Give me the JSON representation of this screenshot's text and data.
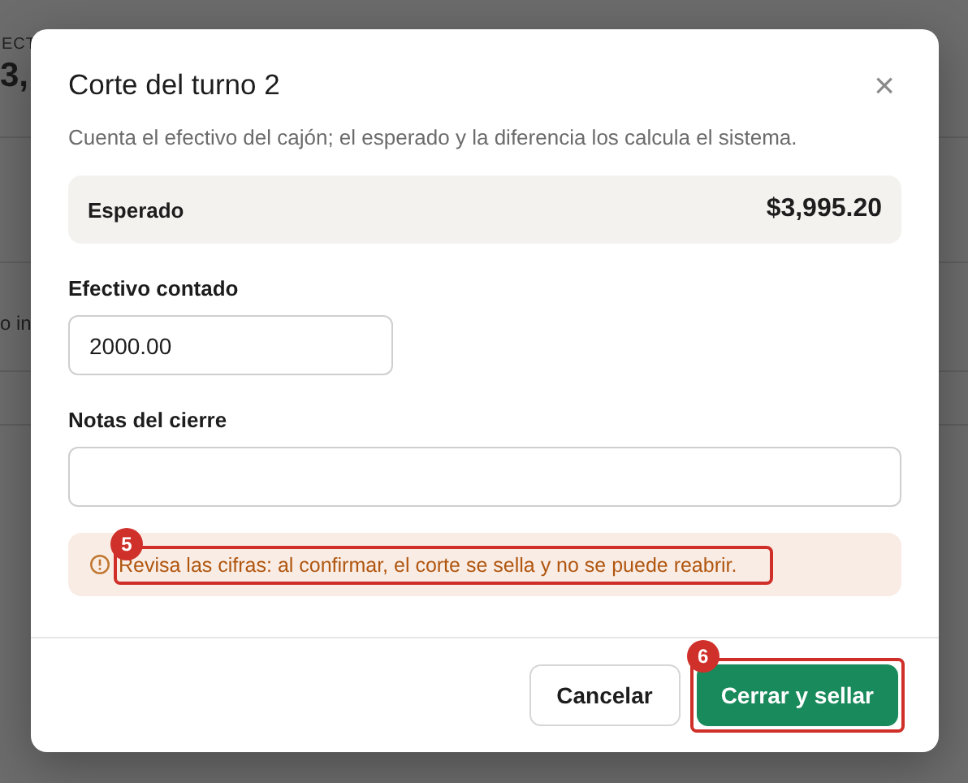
{
  "background": {
    "stat_label": "ECT",
    "stat_value": "3,",
    "row_text": "o in"
  },
  "dialog": {
    "title": "Corte del turno 2",
    "close": "×",
    "description": "Cuenta el efectivo del cajón; el esperado y la diferencia los calcula el sistema.",
    "expected": {
      "label": "Esperado",
      "value": "$3,995.20"
    },
    "fields": [
      {
        "label": "Efectivo contado",
        "value": "2000.00",
        "kind": "short"
      },
      {
        "label": "Notas del cierre",
        "kind": "wide"
      }
    ],
    "warning": {
      "text": "Revisa las cifras: al confirmar, el corte se sella y no se puede reabrir.",
      "annotation": "5"
    },
    "buttons": [
      {
        "label": "Cancelar",
        "kind": "secondary"
      },
      {
        "label": "Cerrar y sellar",
        "kind": "primary",
        "annotation": "6"
      }
    ]
  }
}
